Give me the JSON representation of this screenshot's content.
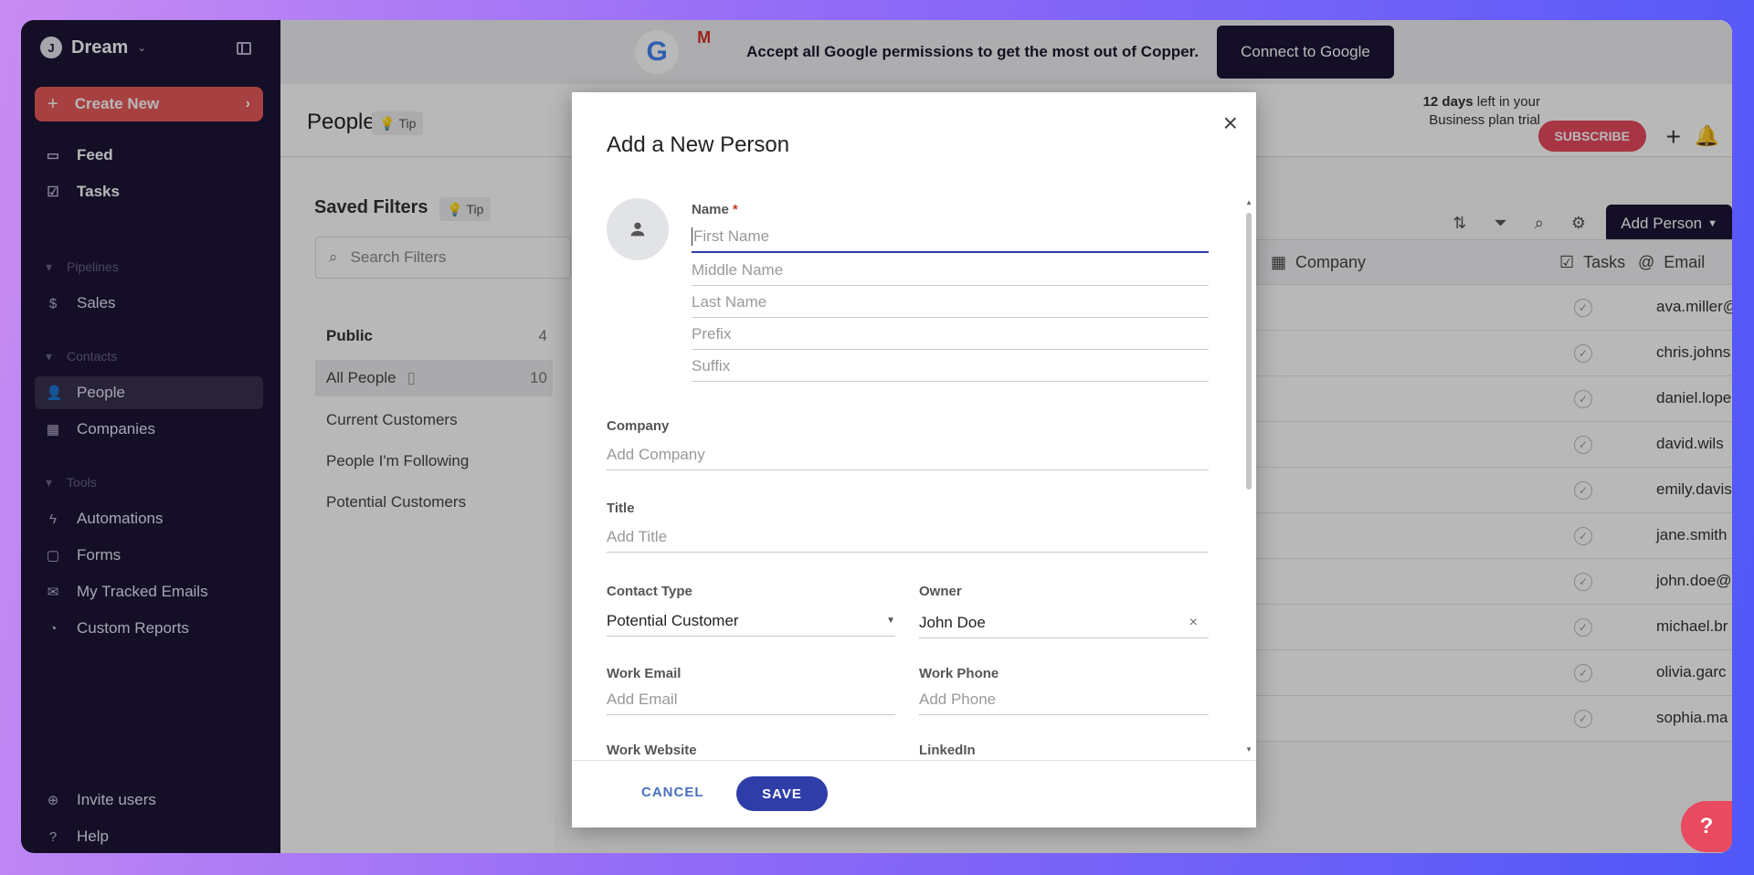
{
  "app": {
    "workspace_initial": "J",
    "workspace_name": "Dream",
    "create_new_label": "Create New"
  },
  "sidebar": {
    "top_items": [
      {
        "label": "Feed",
        "icon": "inbox-icon"
      },
      {
        "label": "Tasks",
        "icon": "checkbox-icon"
      }
    ],
    "sections": {
      "pipelines": "Pipelines",
      "contacts": "Contacts",
      "tools": "Tools"
    },
    "pipeline_items": [
      {
        "label": "Sales",
        "icon": "dollar-icon"
      }
    ],
    "contact_items": [
      {
        "label": "People",
        "icon": "person-icon"
      },
      {
        "label": "Companies",
        "icon": "building-icon"
      }
    ],
    "tool_items": [
      {
        "label": "Automations",
        "icon": "bolt-icon"
      },
      {
        "label": "Forms",
        "icon": "clipboard-icon"
      },
      {
        "label": "My Tracked Emails",
        "icon": "mail-icon"
      },
      {
        "label": "Custom Reports",
        "icon": "chart-icon"
      }
    ],
    "bottom_items": [
      {
        "label": "Invite users",
        "icon": "plus-circle-icon"
      },
      {
        "label": "Help",
        "icon": "help-icon"
      }
    ]
  },
  "banner": {
    "text": "Accept all Google permissions to get the most out of Copper.",
    "button": "Connect to Google"
  },
  "header": {
    "title": "People",
    "tip": "Tip",
    "trial_bold": "12 days",
    "trial_rest": " left in your Business plan trial",
    "subscribe": "SUBSCRIBE"
  },
  "filters": {
    "title": "Saved Filters",
    "tip": "Tip",
    "search_placeholder": "Search Filters",
    "group": "Public",
    "group_count": "4",
    "items": [
      {
        "label": "All People",
        "count": "10"
      },
      {
        "label": "Current Customers",
        "count": ""
      },
      {
        "label": "People I'm Following",
        "count": ""
      },
      {
        "label": "Potential Customers",
        "count": ""
      }
    ]
  },
  "table": {
    "add_person": "Add Person",
    "columns": [
      "Company",
      "Tasks",
      "Email"
    ],
    "emails": [
      "ava.miller@",
      "chris.johns",
      "daniel.lope",
      "david.wils",
      "emily.davis",
      "jane.smith",
      "john.doe@",
      "michael.br",
      "olivia.garc",
      "sophia.ma"
    ]
  },
  "modal": {
    "title": "Add a New Person",
    "name_label": "Name",
    "required_mark": "*",
    "name_fields": [
      "First Name",
      "Middle Name",
      "Last Name",
      "Prefix",
      "Suffix"
    ],
    "company_label": "Company",
    "company_placeholder": "Add Company",
    "title_label": "Title",
    "title_placeholder": "Add Title",
    "contact_type_label": "Contact Type",
    "contact_type_value": "Potential Customer",
    "owner_label": "Owner",
    "owner_value": "John Doe",
    "work_email_label": "Work Email",
    "work_email_placeholder": "Add Email",
    "work_phone_label": "Work Phone",
    "work_phone_placeholder": "Add Phone",
    "work_website_label": "Work Website",
    "linkedin_label": "LinkedIn",
    "cancel": "CANCEL",
    "save": "SAVE"
  }
}
